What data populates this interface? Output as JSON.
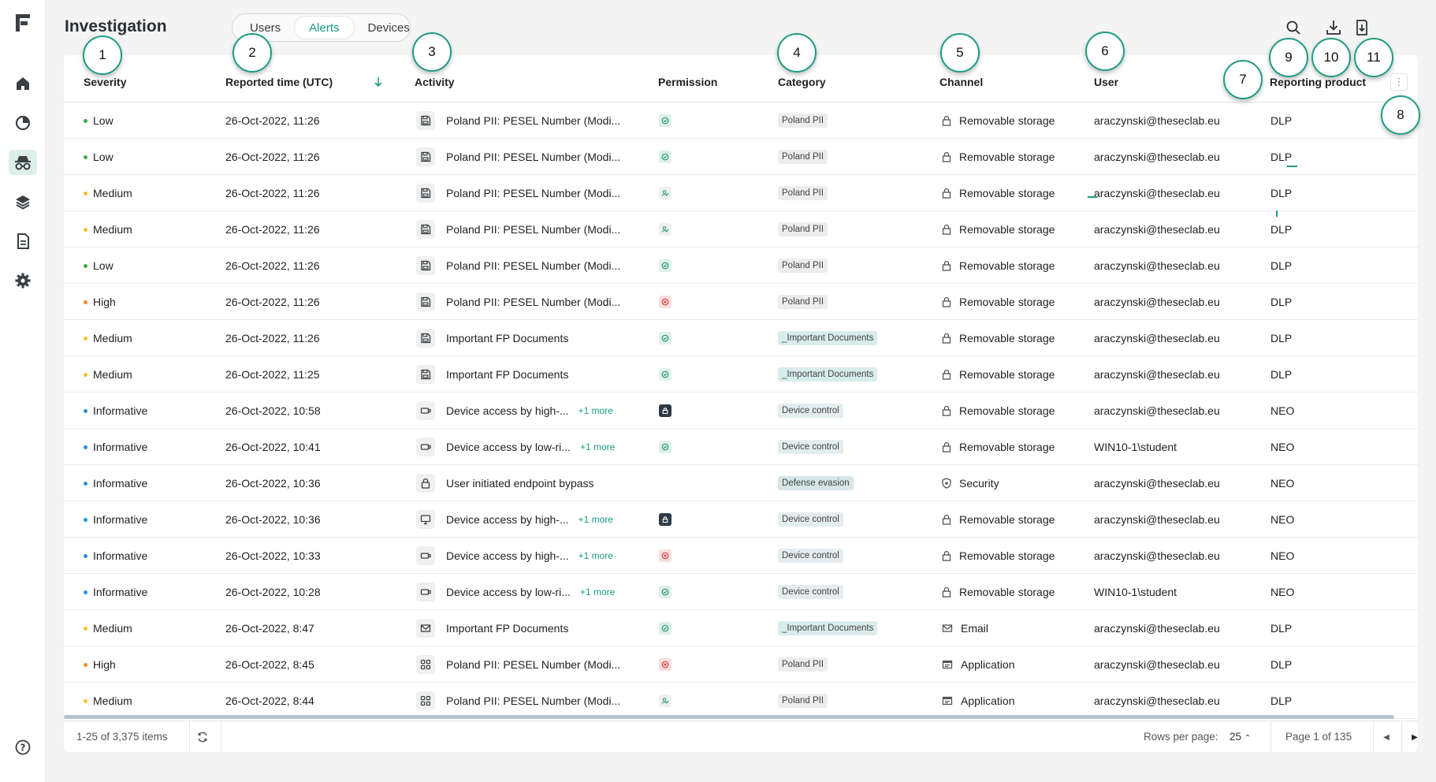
{
  "app": {
    "title": "Investigation",
    "tabs": [
      {
        "label": "Users",
        "active": false
      },
      {
        "label": "Alerts",
        "active": true
      },
      {
        "label": "Devices",
        "active": false
      }
    ],
    "accent": "#1a9b83"
  },
  "sidebar": {
    "logo": "F",
    "items": [
      {
        "icon": "home-icon",
        "active": false
      },
      {
        "icon": "pie-chart-icon",
        "active": false
      },
      {
        "icon": "investigation-icon",
        "active": true
      },
      {
        "icon": "layers-icon",
        "active": false
      },
      {
        "icon": "document-icon",
        "active": false
      },
      {
        "icon": "gear-icon",
        "active": false
      }
    ],
    "bottom_icon": "help-icon"
  },
  "header_icons": [
    "search-icon",
    "download-icon",
    "export-icon",
    "account-icon"
  ],
  "table": {
    "columns": [
      "Severity",
      "Reported time (UTC)",
      "Activity",
      "Permission",
      "Category",
      "Channel",
      "User",
      "Reporting product"
    ],
    "sorted_by": "Reported time (UTC)",
    "rows": [
      {
        "severity": "Low",
        "sevColor": "#3aa84a",
        "time": "26-Oct-2022, 11:26",
        "actIcon": "save",
        "activity": "Poland PII: PESEL Number (Modi...",
        "more": "",
        "perm": "allowed",
        "category": "Poland PII",
        "catStyle": "pii",
        "chIcon": "lock",
        "channel": "Removable storage",
        "user": "araczynski@theseclab.eu",
        "product": "DLP"
      },
      {
        "severity": "Low",
        "sevColor": "#3aa84a",
        "time": "26-Oct-2022, 11:26",
        "actIcon": "save",
        "activity": "Poland PII: PESEL Number (Modi...",
        "more": "",
        "perm": "allowed",
        "category": "Poland PII",
        "catStyle": "pii",
        "chIcon": "lock",
        "channel": "Removable storage",
        "user": "araczynski@theseclab.eu",
        "product": "DLP"
      },
      {
        "severity": "Medium",
        "sevColor": "#f2c230",
        "time": "26-Oct-2022, 11:26",
        "actIcon": "save",
        "activity": "Poland PII: PESEL Number (Modi...",
        "more": "",
        "perm": "user",
        "category": "Poland PII",
        "catStyle": "pii",
        "chIcon": "lock",
        "channel": "Removable storage",
        "user": "araczynski@theseclab.eu",
        "product": "DLP"
      },
      {
        "severity": "Medium",
        "sevColor": "#f2c230",
        "time": "26-Oct-2022, 11:26",
        "actIcon": "save",
        "activity": "Poland PII: PESEL Number (Modi...",
        "more": "",
        "perm": "user",
        "category": "Poland PII",
        "catStyle": "pii",
        "chIcon": "lock",
        "channel": "Removable storage",
        "user": "araczynski@theseclab.eu",
        "product": "DLP"
      },
      {
        "severity": "Low",
        "sevColor": "#3aa84a",
        "time": "26-Oct-2022, 11:26",
        "actIcon": "save",
        "activity": "Poland PII: PESEL Number (Modi...",
        "more": "",
        "perm": "allowed",
        "category": "Poland PII",
        "catStyle": "pii",
        "chIcon": "lock",
        "channel": "Removable storage",
        "user": "araczynski@theseclab.eu",
        "product": "DLP"
      },
      {
        "severity": "High",
        "sevColor": "#f08a24",
        "time": "26-Oct-2022, 11:26",
        "actIcon": "save",
        "activity": "Poland PII: PESEL Number (Modi...",
        "more": "",
        "perm": "blocked",
        "category": "Poland PII",
        "catStyle": "pii",
        "chIcon": "lock",
        "channel": "Removable storage",
        "user": "araczynski@theseclab.eu",
        "product": "DLP"
      },
      {
        "severity": "Medium",
        "sevColor": "#f2c230",
        "time": "26-Oct-2022, 11:26",
        "actIcon": "save",
        "activity": "Important FP Documents",
        "more": "",
        "perm": "allowed",
        "category": "_Important Documents",
        "catStyle": "imp",
        "chIcon": "lock",
        "channel": "Removable storage",
        "user": "araczynski@theseclab.eu",
        "product": "DLP"
      },
      {
        "severity": "Medium",
        "sevColor": "#f2c230",
        "time": "26-Oct-2022, 11:25",
        "actIcon": "save",
        "activity": "Important FP Documents",
        "more": "",
        "perm": "allowed",
        "category": "_Important Documents",
        "catStyle": "imp",
        "chIcon": "lock",
        "channel": "Removable storage",
        "user": "araczynski@theseclab.eu",
        "product": "DLP"
      },
      {
        "severity": "Informative",
        "sevColor": "#2b8fd6",
        "time": "26-Oct-2022, 10:58",
        "actIcon": "device",
        "activity": "Device access by high-...",
        "more": "+1 more",
        "perm": "locked",
        "category": "Device control",
        "catStyle": "dev",
        "chIcon": "lock",
        "channel": "Removable storage",
        "user": "araczynski@theseclab.eu",
        "product": "NEO"
      },
      {
        "severity": "Informative",
        "sevColor": "#2b8fd6",
        "time": "26-Oct-2022, 10:41",
        "actIcon": "device",
        "activity": "Device access by low-ri...",
        "more": "+1 more",
        "perm": "allowed",
        "category": "Device control",
        "catStyle": "dev",
        "chIcon": "lock",
        "channel": "Removable storage",
        "user": "WIN10-1\\student",
        "product": "NEO"
      },
      {
        "severity": "Informative",
        "sevColor": "#2b8fd6",
        "time": "26-Oct-2022, 10:36",
        "actIcon": "padlock",
        "activity": "User initiated endpoint bypass",
        "more": "",
        "perm": "none",
        "category": "Defense evasion",
        "catStyle": "def",
        "chIcon": "shield",
        "channel": "Security",
        "user": "araczynski@theseclab.eu",
        "product": "NEO"
      },
      {
        "severity": "Informative",
        "sevColor": "#2b8fd6",
        "time": "26-Oct-2022, 10:36",
        "actIcon": "monitor",
        "activity": "Device access by high-...",
        "more": "+1 more",
        "perm": "locked",
        "category": "Device control",
        "catStyle": "dev",
        "chIcon": "lock",
        "channel": "Removable storage",
        "user": "araczynski@theseclab.eu",
        "product": "NEO"
      },
      {
        "severity": "Informative",
        "sevColor": "#2b8fd6",
        "time": "26-Oct-2022, 10:33",
        "actIcon": "device",
        "activity": "Device access by high-...",
        "more": "+1 more",
        "perm": "blocked",
        "category": "Device control",
        "catStyle": "dev",
        "chIcon": "lock",
        "channel": "Removable storage",
        "user": "araczynski@theseclab.eu",
        "product": "NEO"
      },
      {
        "severity": "Informative",
        "sevColor": "#2b8fd6",
        "time": "26-Oct-2022, 10:28",
        "actIcon": "device",
        "activity": "Device access by low-ri...",
        "more": "+1 more",
        "perm": "allowed",
        "category": "Device control",
        "catStyle": "dev",
        "chIcon": "lock",
        "channel": "Removable storage",
        "user": "WIN10-1\\student",
        "product": "NEO"
      },
      {
        "severity": "Medium",
        "sevColor": "#f2c230",
        "time": "26-Oct-2022, 8:47",
        "actIcon": "mail",
        "activity": "Important FP Documents",
        "more": "",
        "perm": "allowed",
        "category": "_Important Documents",
        "catStyle": "imp",
        "chIcon": "mail",
        "channel": "Email",
        "user": "araczynski@theseclab.eu",
        "product": "DLP"
      },
      {
        "severity": "High",
        "sevColor": "#f08a24",
        "time": "26-Oct-2022, 8:45",
        "actIcon": "grid",
        "activity": "Poland PII: PESEL Number (Modi...",
        "more": "",
        "perm": "blocked",
        "category": "Poland PII",
        "catStyle": "pii",
        "chIcon": "app",
        "channel": "Application",
        "user": "araczynski@theseclab.eu",
        "product": "DLP"
      },
      {
        "severity": "Medium",
        "sevColor": "#f2c230",
        "time": "26-Oct-2022, 8:44",
        "actIcon": "grid",
        "activity": "Poland PII: PESEL Number (Modi...",
        "more": "",
        "perm": "user",
        "category": "Poland PII",
        "catStyle": "pii",
        "chIcon": "app",
        "channel": "Application",
        "user": "araczynski@theseclab.eu",
        "product": "DLP"
      }
    ]
  },
  "footer": {
    "items_text": "1-25 of 3,375 items",
    "rows_per_page_label": "Rows per page:",
    "rows_per_page_value": "25",
    "page_text": "Page 1 of 135"
  },
  "callouts": [
    "1",
    "2",
    "3",
    "4",
    "5",
    "6",
    "7",
    "8",
    "9",
    "10",
    "11"
  ]
}
